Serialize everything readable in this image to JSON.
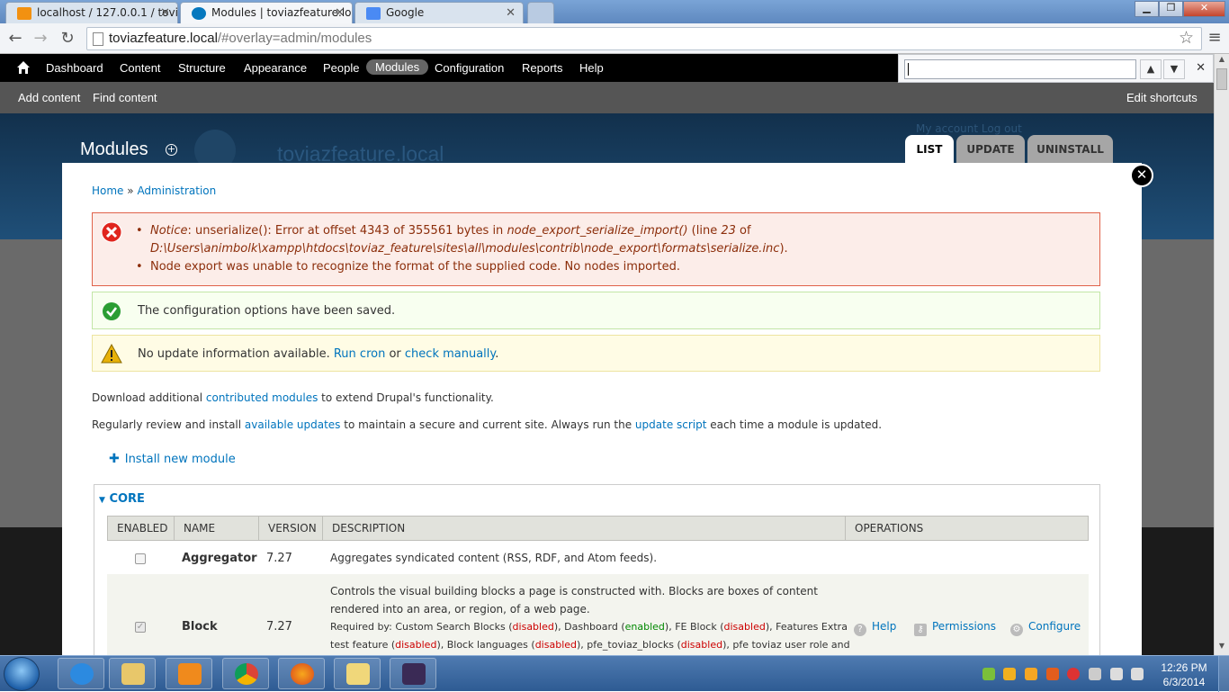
{
  "browser": {
    "tabs": [
      {
        "label": "localhost / 127.0.0.1 / tovi",
        "favicon_color": "#f29111"
      },
      {
        "label": "Modules | toviazfeature.lo",
        "favicon_color": "#0678be"
      },
      {
        "label": "Google",
        "favicon_color": "#4a8af4"
      }
    ],
    "url_host": "toviazfeature.local",
    "url_path": "/#overlay=admin/modules"
  },
  "admin_menu": {
    "items": [
      "Dashboard",
      "Content",
      "Structure",
      "Appearance",
      "People",
      "Modules",
      "Configuration",
      "Reports",
      "Help"
    ],
    "active": "Modules"
  },
  "shortcuts": {
    "items": [
      "Add content",
      "Find content"
    ],
    "edit": "Edit shortcuts"
  },
  "background": {
    "account_links": "My account   Log out",
    "site_name": "toviazfeature.local"
  },
  "page": {
    "title": "Modules",
    "tabs": [
      "LIST",
      "UPDATE",
      "UNINSTALL"
    ],
    "active_tab": "LIST",
    "breadcrumb": {
      "home": "Home",
      "sep": "»",
      "admin": "Administration"
    }
  },
  "messages": {
    "error": {
      "line1_notice": "Notice",
      "line1_text": ": unserialize(): Error at offset 4343 of 355561 bytes in ",
      "line1_func": "node_export_serialize_import()",
      "line1_tail": " (line ",
      "line1_num": "23",
      "line1_of": " of",
      "line2_path": "D:\\Users\\animbolk\\xampp\\htdocs\\toviaz_feature\\sites\\all\\modules\\contrib\\node_export\\formats\\serialize.inc",
      "line2_end": ").",
      "line3": "Node export was unable to recognize the format of the supplied code. No nodes imported."
    },
    "status": "The configuration options have been saved.",
    "warning": {
      "pre": "No update information available. ",
      "link1": "Run cron",
      "mid": " or ",
      "link2": "check manually",
      "end": "."
    }
  },
  "intro": {
    "p1_pre": "Download additional ",
    "p1_link": "contributed modules",
    "p1_post": " to extend Drupal's functionality.",
    "p2_pre": "Regularly review and install ",
    "p2_link1": "available updates",
    "p2_mid": " to maintain a secure and current site. Always run the ",
    "p2_link2": "update script",
    "p2_post": " each time a module is updated."
  },
  "install_link": "Install new module",
  "fieldset": {
    "legend": "CORE",
    "headers": [
      "ENABLED",
      "NAME",
      "VERSION",
      "DESCRIPTION",
      "OPERATIONS"
    ],
    "rows": [
      {
        "enabled": false,
        "name": "Aggregator",
        "version": "7.27",
        "description": "Aggregates syndicated content (RSS, RDF, and Atom feeds)."
      },
      {
        "enabled": true,
        "name": "Block",
        "version": "7.27",
        "description_l1": "Controls the visual building blocks a page is constructed with. Blocks are boxes of content",
        "description_l2": "rendered into an area, or region, of a web page.",
        "required_prefix": "Required by: Custom Search Blocks (",
        "disabled": "disabled",
        "enabled_word": "enabled",
        "req_seg1": "), Dashboard (",
        "req_seg2": "), FE Block (",
        "req_seg3": "), Features Extra",
        "req_l2_seg0": "test feature (",
        "req_l2_seg1": "), Block languages (",
        "req_l2_seg2": "), pfe_toviaz_blocks (",
        "req_l2_seg3": "), pfe toviaz user role and",
        "ops": [
          "Help",
          "Permissions",
          "Configure"
        ]
      }
    ]
  },
  "taskbar": {
    "time": "12:26 PM",
    "date": "6/3/2014"
  }
}
